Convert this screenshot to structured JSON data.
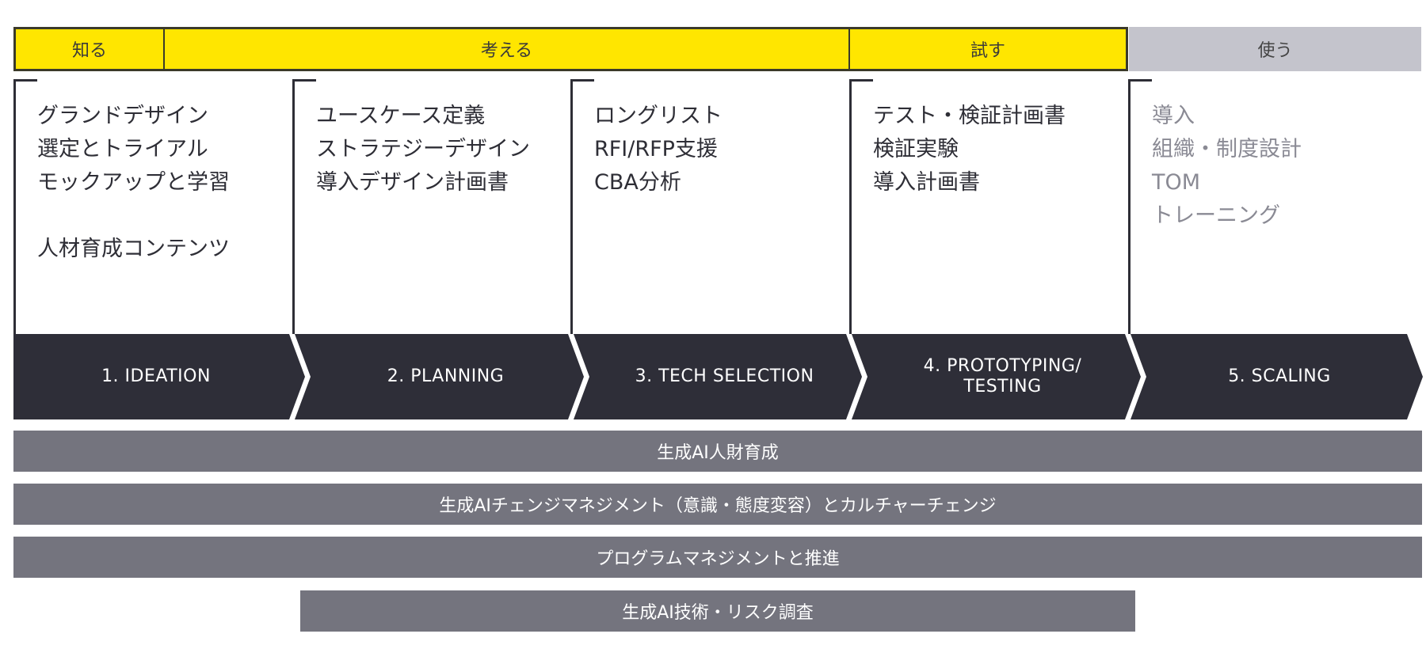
{
  "phases": [
    {
      "label": "知る",
      "color": "#ffe600"
    },
    {
      "label": "考える",
      "color": "#ffe600"
    },
    {
      "label": "試す",
      "color": "#ffe600"
    },
    {
      "label": "使う",
      "color": "#c4c4cc"
    }
  ],
  "columns": [
    {
      "items": [
        "グランドデザイン",
        "選定とトライアル",
        "モックアップと学習",
        "人材育成コンテンツ"
      ]
    },
    {
      "items": [
        "ユースケース定義",
        "ストラテジーデザイン",
        "導入デザイン計画書"
      ]
    },
    {
      "items": [
        "ロングリスト",
        "RFI/RFP支援",
        "CBA分析"
      ]
    },
    {
      "items": [
        "テスト・検証計画書",
        "検証実験",
        "導入計画書"
      ]
    },
    {
      "items": [
        "導入",
        "組織・制度設計",
        "TOM",
        "トレーニング"
      ]
    }
  ],
  "stages": [
    {
      "line1": "1. IDEATION",
      "line2": ""
    },
    {
      "line1": "2. PLANNING",
      "line2": ""
    },
    {
      "line1": "3. TECH SELECTION",
      "line2": ""
    },
    {
      "line1": "4. PROTOTYPING/",
      "line2": "TESTING"
    },
    {
      "line1": "5. SCALING",
      "line2": ""
    }
  ],
  "bands": [
    {
      "label": "生成AI人財育成"
    },
    {
      "label": "生成AIチェンジマネジメント（意識・態度変容）とカルチャーチェンジ"
    },
    {
      "label": "プログラムマネジメントと推進"
    },
    {
      "label": "生成AI技術・リスク調査"
    }
  ],
  "colors": {
    "accent_yellow": "#ffe600",
    "chevron_dark": "#2e2e38",
    "band_grey": "#74747e",
    "phase_grey": "#c4c4cc"
  }
}
